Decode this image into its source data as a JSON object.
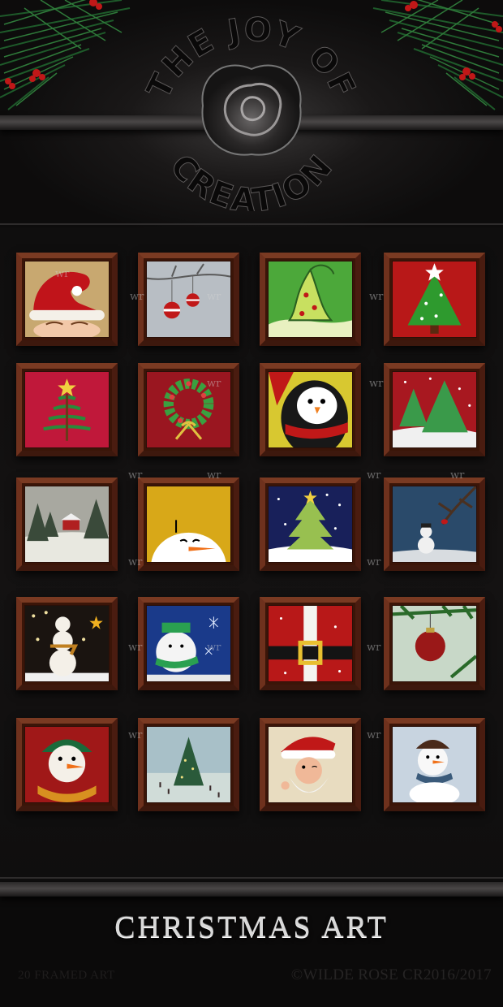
{
  "logo": {
    "text_top": "THE JOY OF",
    "text_bottom": "CREATION"
  },
  "watermark": "wr",
  "paintings": [
    {
      "name": "santa-hat-painting"
    },
    {
      "name": "ornaments-on-branch-painting"
    },
    {
      "name": "whimsical-tree-painting"
    },
    {
      "name": "star-christmas-tree-painting"
    },
    {
      "name": "swirl-tree-painting"
    },
    {
      "name": "wreath-painting"
    },
    {
      "name": "penguin-painting"
    },
    {
      "name": "two-trees-painting"
    },
    {
      "name": "snowy-cabin-painting"
    },
    {
      "name": "peeking-snowman-painting"
    },
    {
      "name": "tree-in-snow-night-painting"
    },
    {
      "name": "snowman-cardinal-painting"
    },
    {
      "name": "snowman-lights-painting"
    },
    {
      "name": "snowman-scarf-painting"
    },
    {
      "name": "santa-belt-painting"
    },
    {
      "name": "red-ornament-painting"
    },
    {
      "name": "snowman-face-painting"
    },
    {
      "name": "skating-rink-tree-painting"
    },
    {
      "name": "winking-santa-painting"
    },
    {
      "name": "snowman-snowflakes-painting"
    }
  ],
  "title": "CHRISTMAS ART",
  "footer": {
    "left": "20 FRAMED ART",
    "right": "©WILDE ROSE CR2016/2017"
  },
  "colors": {
    "background": "#0b0a0a",
    "frame": "#5a2616",
    "title": "#d9d9d9"
  }
}
